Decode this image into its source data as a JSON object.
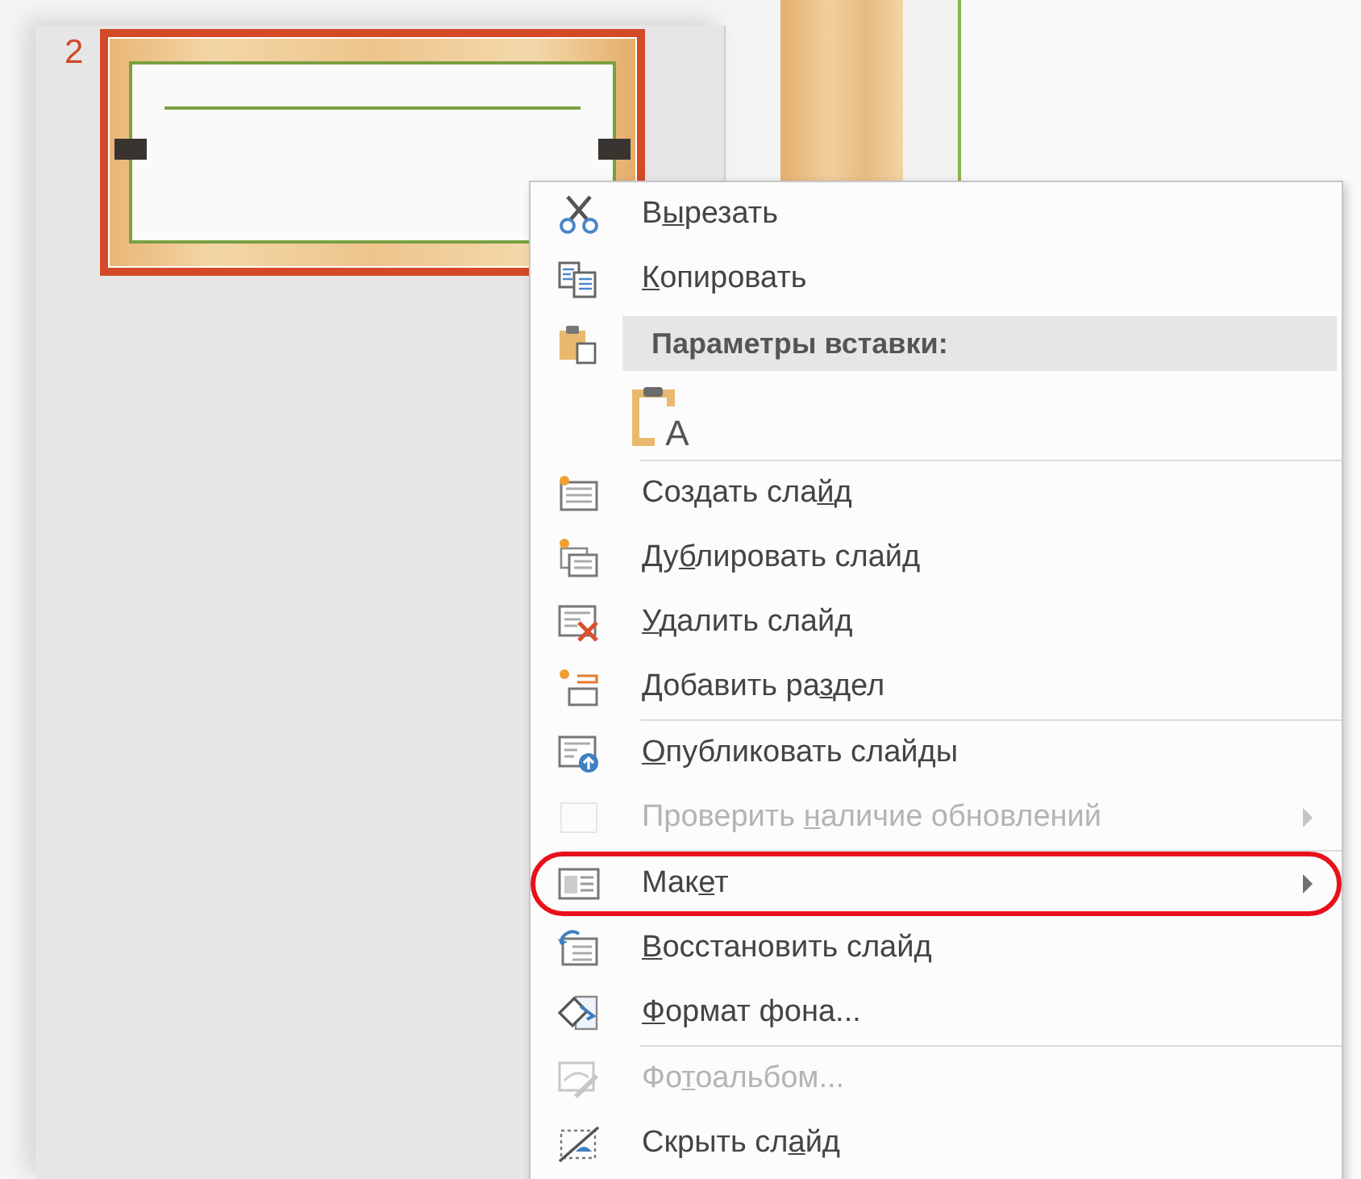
{
  "thumbnails": [
    {
      "number": "2",
      "selected": true
    }
  ],
  "context_menu": {
    "items": [
      {
        "kind": "item",
        "label": {
          "before": "В",
          "key": "ы",
          "after": "резать"
        },
        "disabled": false,
        "submenu": false,
        "annotated": false
      },
      {
        "kind": "item",
        "label": {
          "key": "К",
          "after": "опировать"
        },
        "disabled": false,
        "submenu": false,
        "annotated": false
      },
      {
        "kind": "header",
        "label": "Параметры вставки:"
      },
      {
        "kind": "paste_options",
        "glyph": "A"
      },
      {
        "kind": "separator"
      },
      {
        "kind": "item",
        "label": {
          "before": "Создать сла",
          "key": "й",
          "after": "д"
        },
        "disabled": false,
        "submenu": false,
        "annotated": false
      },
      {
        "kind": "item",
        "label": {
          "before": "Ду",
          "key": "б",
          "after": "лировать слайд"
        },
        "disabled": false,
        "submenu": false,
        "annotated": false
      },
      {
        "kind": "item",
        "label": {
          "key": "У",
          "after": "далить слайд"
        },
        "disabled": false,
        "submenu": false,
        "annotated": false
      },
      {
        "kind": "item",
        "label": {
          "before": "Добавить ра",
          "key": "з",
          "after": "дел"
        },
        "disabled": false,
        "submenu": false,
        "annotated": false
      },
      {
        "kind": "separator"
      },
      {
        "kind": "item",
        "label": {
          "key": "О",
          "after": "публиковать слайды"
        },
        "disabled": false,
        "submenu": false,
        "annotated": false
      },
      {
        "kind": "item",
        "label": {
          "before": "Проверить ",
          "key": "н",
          "after": "аличие обновлений"
        },
        "disabled": true,
        "submenu": true,
        "annotated": false
      },
      {
        "kind": "separator"
      },
      {
        "kind": "item",
        "label": {
          "before": "Мак",
          "key": "е",
          "after": "т"
        },
        "disabled": false,
        "submenu": true,
        "annotated": true
      },
      {
        "kind": "item",
        "label": {
          "key": "В",
          "after": "осстановить слайд"
        },
        "disabled": false,
        "submenu": false,
        "annotated": false
      },
      {
        "kind": "item",
        "label": {
          "key": "Ф",
          "after": "ормат фона..."
        },
        "disabled": false,
        "submenu": false,
        "annotated": false
      },
      {
        "kind": "separator"
      },
      {
        "kind": "item",
        "label": {
          "before": "Фо",
          "key": "т",
          "after": "оальбом..."
        },
        "disabled": true,
        "submenu": false,
        "annotated": false
      },
      {
        "kind": "item",
        "label": {
          "before": "Скрыть сл",
          "key": "а",
          "after": "йд"
        },
        "disabled": false,
        "submenu": false,
        "annotated": false
      }
    ]
  }
}
